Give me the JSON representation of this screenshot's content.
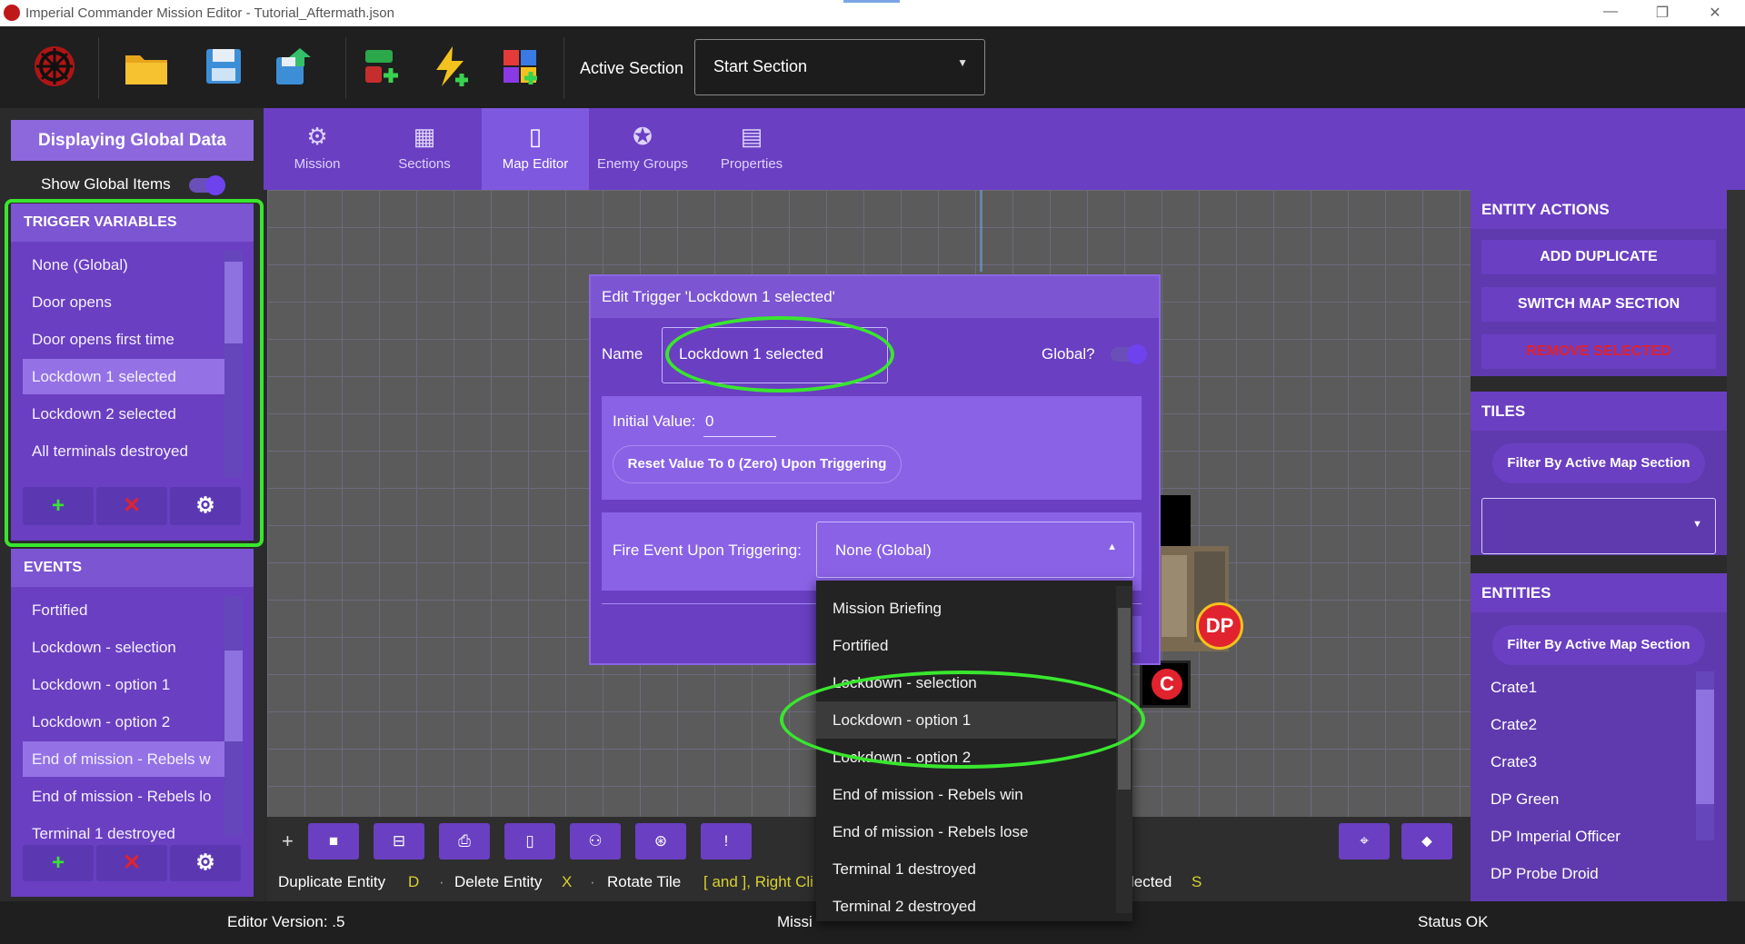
{
  "window": {
    "title": "Imperial Commander Mission Editor - Tutorial_Aftermath.json",
    "controls": [
      "—",
      "❐",
      "✕"
    ]
  },
  "toolbar": {
    "icons": [
      "imperial-logo-icon",
      "open-folder-icon",
      "save-icon",
      "save-as-icon",
      "add-event-icon",
      "lightning-icon",
      "colored-grid-icon"
    ],
    "active_section_label": "Active Section",
    "active_section_value": "Start Section"
  },
  "left": {
    "global_button": "Displaying Global Data",
    "show_global_label": "Show Global Items",
    "trigger_header": "TRIGGER VARIABLES",
    "triggers": [
      "None (Global)",
      "Door opens",
      "Door opens first time",
      "Lockdown 1 selected",
      "Lockdown 2 selected",
      "All terminals destroyed"
    ],
    "trigger_selected_index": 3,
    "events_header": "EVENTS",
    "events": [
      "Fortified",
      "Lockdown - selection",
      "Lockdown - option 1",
      "Lockdown - option 2",
      "End of mission - Rebels w",
      "End of mission - Rebels lo",
      "Terminal 1 destroyed"
    ],
    "event_selected_index": 4,
    "add_symbol": "+",
    "delete_symbol": "✕",
    "settings_symbol": "⚙"
  },
  "tabs": [
    {
      "label": "Mission",
      "icon": "gear-icon"
    },
    {
      "label": "Sections",
      "icon": "grid-icon"
    },
    {
      "label": "Map Editor",
      "icon": "map-icon"
    },
    {
      "label": "Enemy Groups",
      "icon": "empire-icon"
    },
    {
      "label": "Properties",
      "icon": "properties-icon"
    }
  ],
  "active_tab_index": 2,
  "dialog": {
    "title": "Edit Trigger 'Lockdown 1 selected'",
    "name_label": "Name",
    "name_value": "Lockdown 1 selected",
    "global_label": "Global?",
    "initial_label": "Initial Value:",
    "initial_value": "0",
    "reset_button": "Reset Value To 0 (Zero) Upon Triggering",
    "fire_label": "Fire Event Upon Triggering:",
    "fire_value": "None (Global)"
  },
  "dropdown": {
    "items": [
      "Mission Briefing",
      "Fortified",
      "Lockdown - selection",
      "Lockdown - option 1",
      "Lockdown - option 2",
      "End of mission - Rebels win",
      "End of mission - Rebels lose",
      "Terminal 1 destroyed",
      "Terminal 2 destroyed"
    ],
    "highlighted_index": 3
  },
  "map": {
    "tokens": {
      "dp": "DP",
      "c": "C"
    }
  },
  "map_toolbar": {
    "add": "+",
    "tool_icons": [
      "square-icon",
      "stamp-icon",
      "printer-icon",
      "door-icon",
      "group-icon",
      "target-icon",
      "alert-icon"
    ],
    "right_icons": [
      "crosshair-icon",
      "tag-icon"
    ]
  },
  "shortcuts": [
    {
      "label": "Duplicate Entity",
      "key": "D"
    },
    {
      "label": "Delete Entity",
      "key": "X"
    },
    {
      "label": "Rotate Tile",
      "key": "[ and ], Right Cli"
    },
    {
      "label": "lected",
      "key": "S"
    }
  ],
  "right": {
    "entity_actions_header": "ENTITY ACTIONS",
    "add_duplicate": "ADD DUPLICATE",
    "switch_map_section": "SWITCH MAP SECTION",
    "remove_selected": "REMOVE SELECTED",
    "tiles_header": "TILES",
    "filter_label": "Filter By Active Map Section",
    "entities_header": "ENTITIES",
    "entities": [
      "Crate1",
      "Crate2",
      "Crate3",
      "DP Green",
      "DP Imperial Officer",
      "DP Probe Droid"
    ]
  },
  "status": {
    "version": "Editor Version: .5",
    "middle": "Missi",
    "status": "Status OK"
  },
  "colors": {
    "accent": "#6a3fc2",
    "highlight_green": "#39e62e",
    "remove_red": "#e0232e",
    "key_yellow": "#d8d22f"
  }
}
